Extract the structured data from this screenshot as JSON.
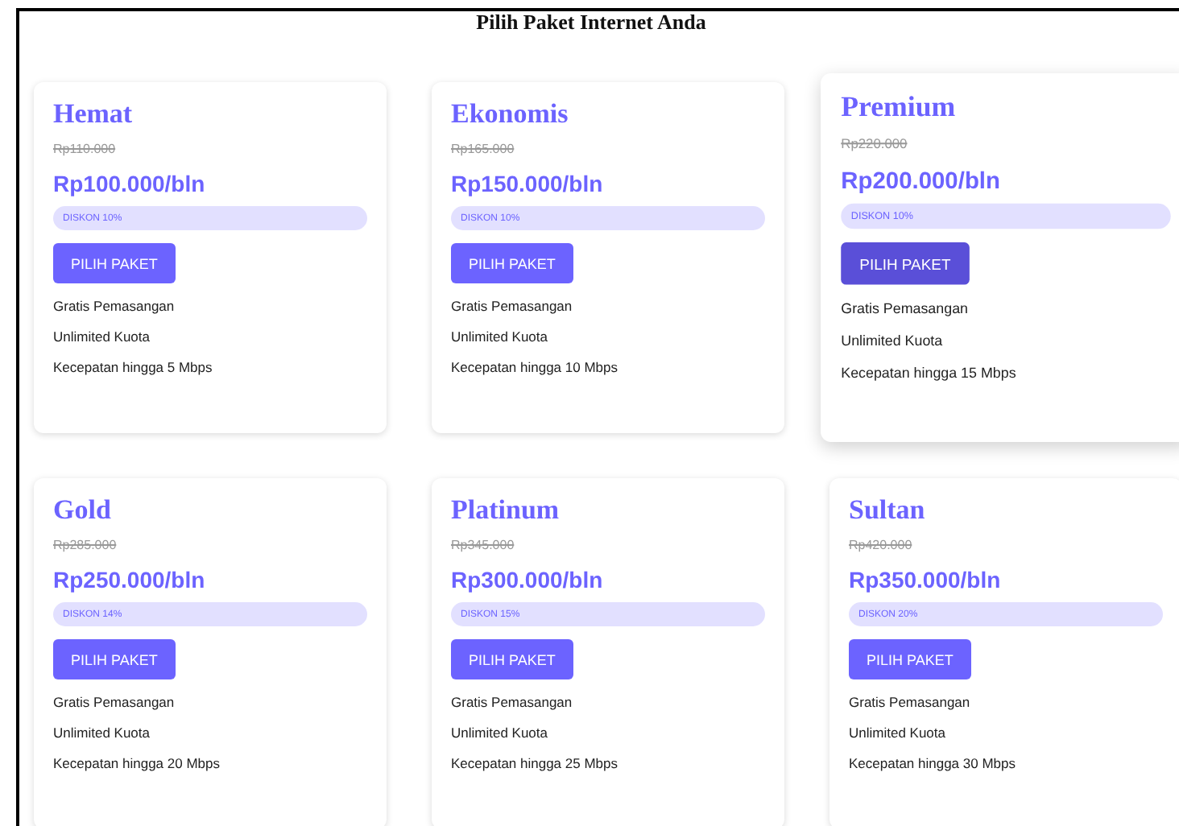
{
  "title": "Pilih Paket Internet Anda",
  "plans": [
    {
      "name": "Hemat",
      "old_price": "Rp110.000",
      "price": "Rp100.000/bln",
      "discount": "DISKON 10%",
      "button": "PILIH PAKET",
      "highlighted": false,
      "features": [
        "Gratis Pemasangan",
        "Unlimited Kuota",
        "Kecepatan hingga 5 Mbps"
      ]
    },
    {
      "name": "Ekonomis",
      "old_price": "Rp165.000",
      "price": "Rp150.000/bln",
      "discount": "DISKON 10%",
      "button": "PILIH PAKET",
      "highlighted": false,
      "features": [
        "Gratis Pemasangan",
        "Unlimited Kuota",
        "Kecepatan hingga 10 Mbps"
      ]
    },
    {
      "name": "Premium",
      "old_price": "Rp220.000",
      "price": "Rp200.000/bln",
      "discount": "DISKON 10%",
      "button": "PILIH PAKET",
      "highlighted": true,
      "features": [
        "Gratis Pemasangan",
        "Unlimited Kuota",
        "Kecepatan hingga 15 Mbps"
      ]
    },
    {
      "name": "Gold",
      "old_price": "Rp285.000",
      "price": "Rp250.000/bln",
      "discount": "DISKON 14%",
      "button": "PILIH PAKET",
      "highlighted": false,
      "features": [
        "Gratis Pemasangan",
        "Unlimited Kuota",
        "Kecepatan hingga 20 Mbps"
      ]
    },
    {
      "name": "Platinum",
      "old_price": "Rp345.000",
      "price": "Rp300.000/bln",
      "discount": "DISKON 15%",
      "button": "PILIH PAKET",
      "highlighted": false,
      "features": [
        "Gratis Pemasangan",
        "Unlimited Kuota",
        "Kecepatan hingga 25 Mbps"
      ]
    },
    {
      "name": "Sultan",
      "old_price": "Rp420.000",
      "price": "Rp350.000/bln",
      "discount": "DISKON 20%",
      "button": "PILIH PAKET",
      "highlighted": false,
      "features": [
        "Gratis Pemasangan",
        "Unlimited Kuota",
        "Kecepatan hingga 30 Mbps"
      ]
    }
  ]
}
